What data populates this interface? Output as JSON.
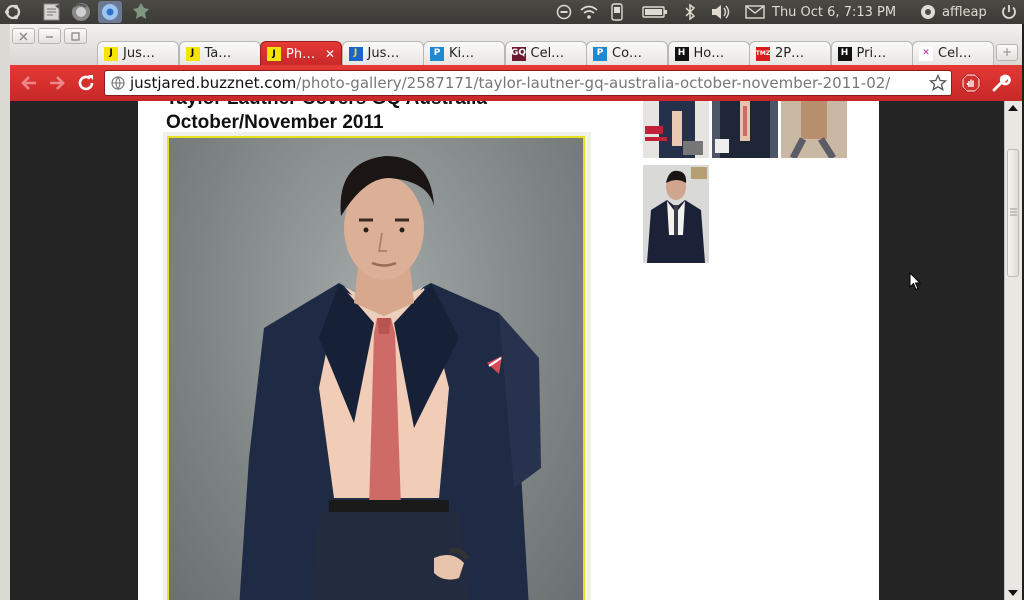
{
  "panel": {
    "clock": "Thu Oct  6,  7:13 PM",
    "user": "affleap"
  },
  "browser": {
    "tabs": [
      {
        "label": "Jus…",
        "favicon": "J",
        "favicon_bg": "#f5e400",
        "favicon_fg": "#000",
        "active": false
      },
      {
        "label": "Ta…",
        "favicon": "J",
        "favicon_bg": "#f5e400",
        "favicon_fg": "#000",
        "active": false
      },
      {
        "label": "Ph…",
        "favicon": "J",
        "favicon_bg": "#f5e400",
        "favicon_fg": "#000",
        "active": true
      },
      {
        "label": "Jus…",
        "favicon": "J",
        "favicon_bg": "#1e63c9",
        "favicon_fg": "#f5e400",
        "active": false
      },
      {
        "label": "Ki…",
        "favicon": "P",
        "favicon_bg": "#1e88d0",
        "favicon_fg": "#fff",
        "active": false
      },
      {
        "label": "Cel…",
        "favicon": "GQ",
        "favicon_bg": "#6b1b2e",
        "favicon_fg": "#fff",
        "active": false
      },
      {
        "label": "Co…",
        "favicon": "P",
        "favicon_bg": "#1e88d0",
        "favicon_fg": "#fff",
        "active": false
      },
      {
        "label": "Ho…",
        "favicon": "H",
        "favicon_bg": "#111",
        "favicon_fg": "#fff",
        "active": false
      },
      {
        "label": "2P…",
        "favicon": "TMZ",
        "favicon_bg": "#d81c1c",
        "favicon_fg": "#fff",
        "active": false
      },
      {
        "label": "Pri…",
        "favicon": "H",
        "favicon_bg": "#111",
        "favicon_fg": "#fff",
        "active": false
      },
      {
        "label": "Cel…",
        "favicon": "✕",
        "favicon_bg": "#ffffff",
        "favicon_fg": "#c21ca7",
        "active": false
      }
    ],
    "url_host": "justjared.buzznet.com",
    "url_path": "/photo-gallery/2587171/taylor-lautner-gq-australia-october-november-2011-02/"
  },
  "article": {
    "title_line1": "Taylor Lautner Covers GQ Australia",
    "title_line2": "October/November 2011"
  },
  "colors": {
    "chrome_red": "#c62828",
    "photo_border": "#e6e021"
  }
}
